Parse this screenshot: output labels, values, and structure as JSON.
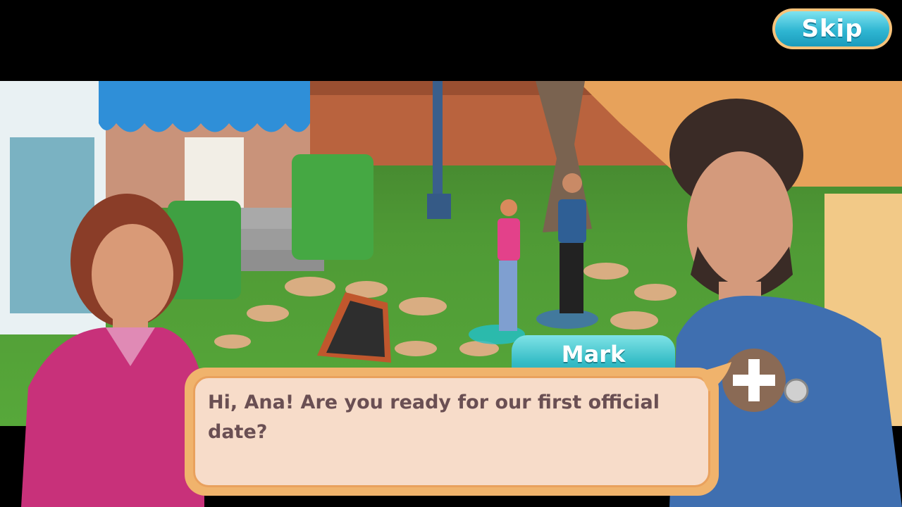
{
  "skip": {
    "label": "Skip"
  },
  "dialog": {
    "speaker": "Mark",
    "text": "Hi, Ana! Are you ready for our first official date?"
  },
  "colors": {
    "skip_button": "#2fb6d2",
    "name_tab": "#35bcc6",
    "dialog_frame": "#f0b36c",
    "dialog_fill": "#f7dcc9",
    "dialog_text": "#6a4f53"
  }
}
